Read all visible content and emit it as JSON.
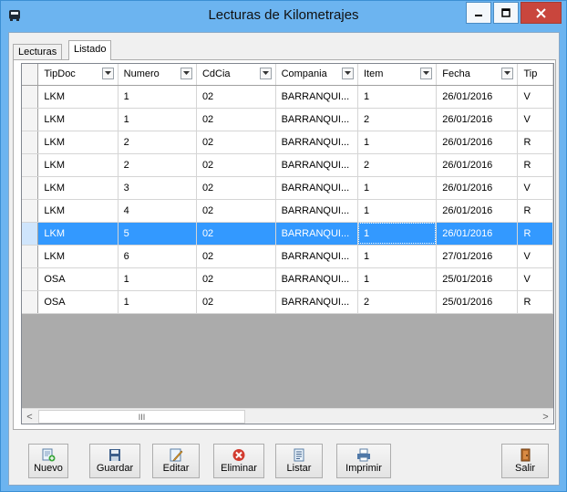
{
  "window": {
    "title": "Lecturas de Kilometrajes"
  },
  "tabs": [
    {
      "label": "Lecturas",
      "selected": false
    },
    {
      "label": "Listado",
      "selected": true
    }
  ],
  "grid": {
    "columns": [
      "TipDoc",
      "Numero",
      "CdCia",
      "Compania",
      "Item",
      "Fecha",
      "Tip"
    ],
    "rows": [
      [
        "LKM",
        "1",
        "02",
        "BARRANQUI...",
        "1",
        "26/01/2016",
        "V"
      ],
      [
        "LKM",
        "1",
        "02",
        "BARRANQUI...",
        "2",
        "26/01/2016",
        "V"
      ],
      [
        "LKM",
        "2",
        "02",
        "BARRANQUI...",
        "1",
        "26/01/2016",
        "R"
      ],
      [
        "LKM",
        "2",
        "02",
        "BARRANQUI...",
        "2",
        "26/01/2016",
        "R"
      ],
      [
        "LKM",
        "3",
        "02",
        "BARRANQUI...",
        "1",
        "26/01/2016",
        "V"
      ],
      [
        "LKM",
        "4",
        "02",
        "BARRANQUI...",
        "1",
        "26/01/2016",
        "R"
      ],
      [
        "LKM",
        "5",
        "02",
        "BARRANQUI...",
        "1",
        "26/01/2016",
        "R"
      ],
      [
        "LKM",
        "6",
        "02",
        "BARRANQUI...",
        "1",
        "27/01/2016",
        "V"
      ],
      [
        "OSA",
        "1",
        "02",
        "BARRANQUI...",
        "1",
        "25/01/2016",
        "V"
      ],
      [
        "OSA",
        "1",
        "02",
        "BARRANQUI...",
        "2",
        "25/01/2016",
        "R"
      ]
    ],
    "selected_row_index": 6,
    "scrollbar": {
      "left_arrow": "<",
      "right_arrow": ">",
      "thumb_grip": "III"
    }
  },
  "toolbar": {
    "buttons": [
      {
        "id": "nuevo",
        "label": "Nuevo",
        "icon": "new-document-icon"
      },
      {
        "id": "guardar",
        "label": "Guardar",
        "icon": "save-disk-icon"
      },
      {
        "id": "editar",
        "label": "Editar",
        "icon": "edit-pencil-icon"
      },
      {
        "id": "eliminar",
        "label": "Eliminar",
        "icon": "delete-red-x-icon"
      },
      {
        "id": "listar",
        "label": "Listar",
        "icon": "list-document-icon"
      },
      {
        "id": "imprimir",
        "label": "Imprimir",
        "icon": "printer-icon"
      },
      {
        "id": "salir",
        "label": "Salir",
        "icon": "exit-door-icon"
      }
    ]
  },
  "colors": {
    "title_bar": "#6cb4f0",
    "selection": "#3399ff",
    "close_button": "#c9463d",
    "grid_background": "#ababab"
  }
}
